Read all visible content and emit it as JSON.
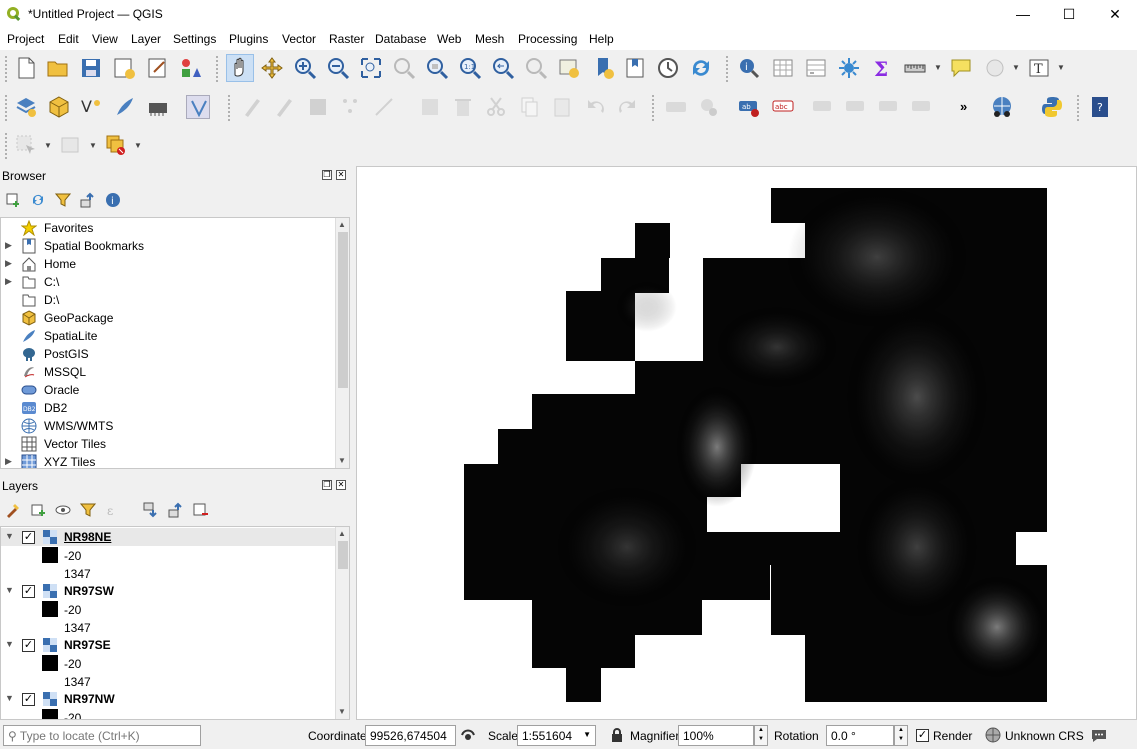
{
  "window": {
    "title": "*Untitled Project — QGIS",
    "minimize_glyph": "—",
    "maximize_glyph": "☐",
    "close_glyph": "✕"
  },
  "menubar": {
    "items": [
      "Project",
      "Edit",
      "View",
      "Layer",
      "Settings",
      "Plugins",
      "Vector",
      "Raster",
      "Database",
      "Web",
      "Mesh",
      "Processing",
      "Help"
    ]
  },
  "toolbar": {
    "overflow_glyph": "»"
  },
  "browser": {
    "title": "Browser",
    "items": [
      {
        "label": "Favorites",
        "icon": "star-icon",
        "expandable": false
      },
      {
        "label": "Spatial Bookmarks",
        "icon": "bookmark-icon",
        "expandable": true
      },
      {
        "label": "Home",
        "icon": "home-icon",
        "expandable": true
      },
      {
        "label": "C:\\",
        "icon": "drive-icon",
        "expandable": true
      },
      {
        "label": "D:\\",
        "icon": "drive-icon",
        "expandable": false
      },
      {
        "label": "GeoPackage",
        "icon": "geopackage-icon",
        "expandable": false
      },
      {
        "label": "SpatiaLite",
        "icon": "spatialite-icon",
        "expandable": false
      },
      {
        "label": "PostGIS",
        "icon": "postgis-icon",
        "expandable": false
      },
      {
        "label": "MSSQL",
        "icon": "mssql-icon",
        "expandable": false
      },
      {
        "label": "Oracle",
        "icon": "oracle-icon",
        "expandable": false
      },
      {
        "label": "DB2",
        "icon": "db2-icon",
        "expandable": false
      },
      {
        "label": "WMS/WMTS",
        "icon": "wms-icon",
        "expandable": false
      },
      {
        "label": "Vector Tiles",
        "icon": "vector-tiles-icon",
        "expandable": false
      },
      {
        "label": "XYZ Tiles",
        "icon": "xyz-tiles-icon",
        "expandable": true
      }
    ]
  },
  "layers": {
    "title": "Layers",
    "items": [
      {
        "name": "NR98NE",
        "checked": true,
        "selected": true,
        "min": "-20",
        "max": "1347"
      },
      {
        "name": "NR97SW",
        "checked": true,
        "selected": false,
        "min": "-20",
        "max": "1347"
      },
      {
        "name": "NR97SE",
        "checked": true,
        "selected": false,
        "min": "-20",
        "max": "1347"
      },
      {
        "name": "NR97NW",
        "checked": true,
        "selected": false,
        "min": "-20",
        "max": ""
      }
    ]
  },
  "statusbar": {
    "locator_placeholder": "Type to locate (Ctrl+K)",
    "coordinate_label": "Coordinate",
    "coordinate_value": "99526,674504",
    "scale_label": "Scale",
    "scale_value": "1:551604",
    "magnifier_label": "Magnifier",
    "magnifier_value": "100%",
    "rotation_label": "Rotation",
    "rotation_value": "0.0 °",
    "render_label": "Render",
    "render_checked": true,
    "crs_label": "Unknown CRS"
  },
  "colors": {
    "accent": "#0078d7",
    "qgis_green": "#589632",
    "raster_black": "#000000"
  }
}
